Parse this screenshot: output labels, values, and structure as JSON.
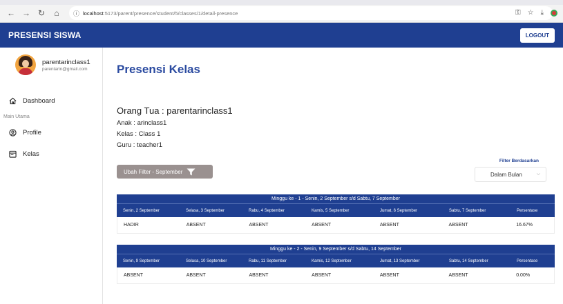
{
  "browser": {
    "url_host": "localhost",
    "url_path": ":5173/parent/presence/student/5/classes/1/detail-presence"
  },
  "app": {
    "brand": "PRESENSI SISWA",
    "logout_label": "LOGOUT"
  },
  "sidebar": {
    "user_name": "parentarinclass1",
    "user_email": "parentarin@gmail.com",
    "dashboard_label": "Dashboard",
    "section_label": "Main Utama",
    "profile_label": "Profile",
    "kelas_label": "Kelas"
  },
  "main": {
    "title": "Presensi Kelas",
    "parent_line": "Orang Tua : parentarinclass1",
    "child_line": "Anak : arinclass1",
    "class_line": "Kelas : Class 1",
    "teacher_line": "Guru : teacher1",
    "filter_button": "Ubah Filter - September",
    "filter_label": "Filter Berdasarkan",
    "filter_value": "Dalam Bulan"
  },
  "weeks": [
    {
      "title": "Minggu ke - 1 - Senin, 2 September s/d Sabtu, 7 September",
      "headers": [
        "Senin, 2 September",
        "Selasa, 3 September",
        "Rabu, 4 September",
        "Kamis, 5 September",
        "Jumat, 6 September",
        "Sabtu, 7 September",
        "Persentase"
      ],
      "values": [
        "HADIR",
        "ABSENT",
        "ABSENT",
        "ABSENT",
        "ABSENT",
        "ABSENT",
        "16.67%"
      ]
    },
    {
      "title": "Minggu ke - 2 - Senin, 9 September s/d Sabtu, 14 September",
      "headers": [
        "Senin, 9 September",
        "Selasa, 10 September",
        "Rabu, 11 September",
        "Kamis, 12 September",
        "Jumat, 13 September",
        "Sabtu, 14 September",
        "Persentase"
      ],
      "values": [
        "ABSENT",
        "ABSENT",
        "ABSENT",
        "ABSENT",
        "ABSENT",
        "ABSENT",
        "0.00%"
      ]
    }
  ],
  "colors": {
    "primary": "#1f3f91",
    "title": "#2a4aa0",
    "filter_button": "#9a9190"
  }
}
